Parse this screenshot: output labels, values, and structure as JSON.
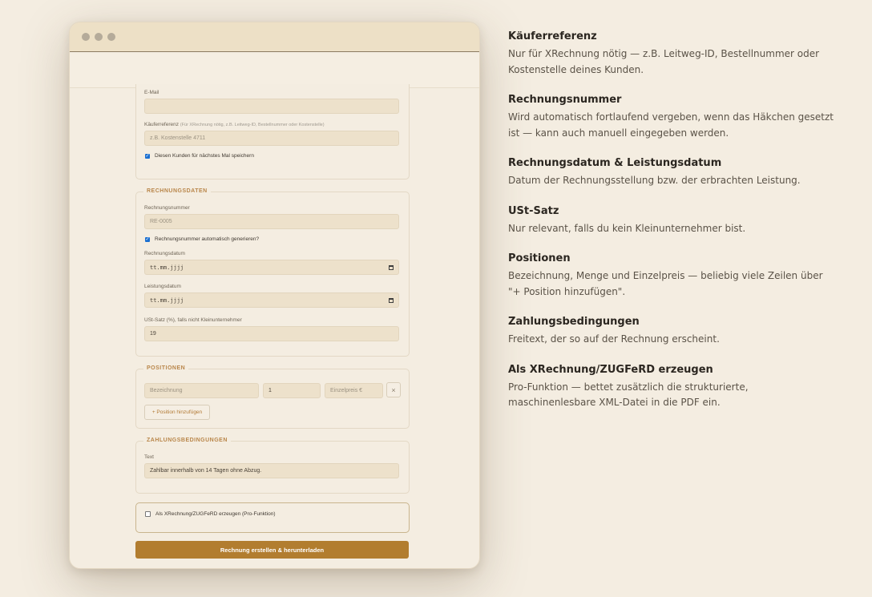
{
  "form": {
    "email_label": "E-Mail",
    "email_value": "",
    "buyer_ref_label": "Käuferreferenz",
    "buyer_ref_hint": "(Für XRechnung nötig, z.B. Leitweg-ID, Bestellnummer oder Kostenstelle)",
    "buyer_ref_placeholder": "z.B. Kostenstelle 4711",
    "save_customer_label": "Diesen Kunden für nächstes Mal speichern",
    "save_customer_checked": true
  },
  "invoice": {
    "legend": "RECHNUNGSDATEN",
    "number_label": "Rechnungsnummer",
    "number_value": "RE-0005",
    "auto_label": "Rechnungsnummer automatisch generieren?",
    "auto_checked": true,
    "date_label": "Rechnungsdatum",
    "date_value": "tt.mm.jjjj",
    "service_label": "Leistungsdatum",
    "service_value": "tt.mm.jjjj",
    "vat_label": "USt-Satz (%), falls nicht Kleinunternehmer",
    "vat_value": "19"
  },
  "positions": {
    "legend": "POSITIONEN",
    "desc_placeholder": "Bezeichnung",
    "qty_value": "1",
    "price_placeholder": "Einzelpreis €",
    "remove_glyph": "×",
    "add_label": "+ Position hinzufügen"
  },
  "payment": {
    "legend": "ZAHLUNGSBEDINGUNGEN",
    "text_label": "Text",
    "text_value": "Zahlbar innerhalb von 14 Tagen ohne Abzug."
  },
  "xrechnung": {
    "label": "Als XRechnung/ZUGFeRD erzeugen (Pro-Funktion)",
    "checked": false
  },
  "submit_label": "Rechnung erstellen & herunterladen",
  "help": [
    {
      "title": "Käuferreferenz",
      "text": "Nur für XRechnung nötig — z.B. Leitweg-ID, Bestellnummer oder Kostenstelle deines Kunden."
    },
    {
      "title": "Rechnungsnummer",
      "text": "Wird automatisch fortlaufend vergeben, wenn das Häkchen gesetzt ist — kann auch manuell eingegeben werden."
    },
    {
      "title": "Rechnungsdatum & Leistungsdatum",
      "text": "Datum der Rechnungsstellung bzw. der erbrachten Leistung."
    },
    {
      "title": "USt-Satz",
      "text": "Nur relevant, falls du kein Kleinunternehmer bist."
    },
    {
      "title": "Positionen",
      "text": "Bezeichnung, Menge und Einzelpreis — beliebig viele Zeilen über \"+ Position hinzufügen\"."
    },
    {
      "title": "Zahlungsbedingungen",
      "text": "Freitext, der so auf der Rechnung erscheint."
    },
    {
      "title": "Als XRechnung/ZUGFeRD erzeugen",
      "text": "Pro-Funktion — bettet zusätzlich die strukturierte, maschinenlesbare XML-Datei in die PDF ein."
    }
  ],
  "colors": {
    "accent": "#b27d2f",
    "background": "#f4ede1",
    "input": "#ede1cb"
  }
}
